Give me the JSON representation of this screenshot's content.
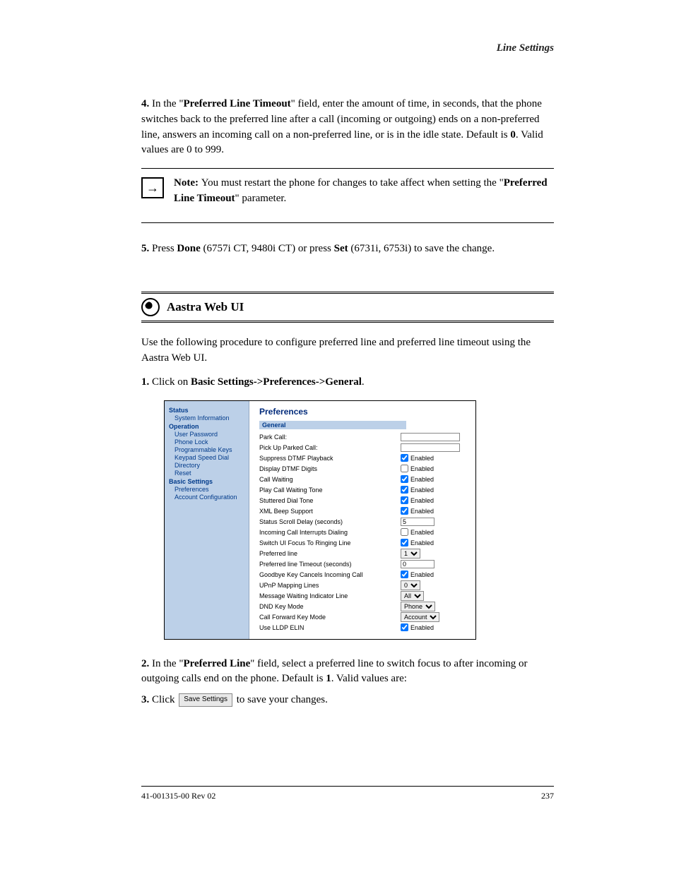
{
  "header": {
    "right_title": "Line Settings"
  },
  "paragraphs": {
    "p1_prefix": "4.",
    "p1": "In the \"",
    "p1_bold": "Preferred Line Timeout",
    "p1_suffix": "\" field, enter the amount of time, in seconds, that the phone switches back to the preferred line after a call (incoming or outgoing) ends on a non-preferred line, answers an incoming call on a non-preferred line, or is in the idle state. Default is ",
    "p1_default": "0",
    "p1_tail": ". Valid values are 0 to 999.",
    "p2_prefix": "5.",
    "p2_a": "Press ",
    "p2_b": "Done",
    "p2_c": " (6757i CT, 9480i CT) or press ",
    "p2_d": "Set",
    "p2_e": " (6731i, 6753i) to save the change.",
    "note_label": "Note: ",
    "note_body": "You must restart the phone for changes to take affect when setting the \"",
    "note_bold": "Preferred Line Timeout",
    "note_tail": "\" parameter.",
    "webui_heading": "Aastra Web UI",
    "intro": "Use the following procedure to configure preferred line and preferred line timeout using the Aastra Web UI.",
    "s1_prefix": "1.",
    "s1_a": "Click on ",
    "s1_b": "Basic Settings->Preferences->General",
    "s1_c": ".",
    "s2_prefix": "2.",
    "s2_a": "In the \"",
    "s2_b": "Preferred Line",
    "s2_c": "\" field, select a preferred line to switch focus to after incoming or outgoing calls end on the phone. Default is ",
    "s2_d": "1",
    "s2_e": ". Valid values are:",
    "s3_prefix": "3.",
    "s3_a": "Click ",
    "s3_savebtn": "Save Settings",
    "s3_b": " to save your changes."
  },
  "shot": {
    "sidebar": {
      "status": "Status",
      "items1": [
        "System Information"
      ],
      "operation": "Operation",
      "items2": [
        "User Password",
        "Phone Lock",
        "Programmable Keys",
        "Keypad Speed Dial",
        "Directory",
        "Reset"
      ],
      "basic": "Basic Settings",
      "items3": [
        "Preferences",
        "Account Configuration"
      ]
    },
    "title": "Preferences",
    "section": "General",
    "rows": [
      {
        "label": "Park Call:",
        "type": "text",
        "value": ""
      },
      {
        "label": "Pick Up Parked Call:",
        "type": "text",
        "value": ""
      },
      {
        "label": "Suppress DTMF Playback",
        "type": "check",
        "checked": true,
        "sfx": "Enabled"
      },
      {
        "label": "Display DTMF Digits",
        "type": "check",
        "checked": false,
        "sfx": "Enabled"
      },
      {
        "label": "Call Waiting",
        "type": "check",
        "checked": true,
        "sfx": "Enabled"
      },
      {
        "label": "Play Call Waiting Tone",
        "type": "check",
        "checked": true,
        "sfx": "Enabled"
      },
      {
        "label": "Stuttered Dial Tone",
        "type": "check",
        "checked": true,
        "sfx": "Enabled"
      },
      {
        "label": "XML Beep Support",
        "type": "check",
        "checked": true,
        "sfx": "Enabled"
      },
      {
        "label": "Status Scroll Delay (seconds)",
        "type": "text",
        "value": "5",
        "cls": "med"
      },
      {
        "label": "Incoming Call Interrupts Dialing",
        "type": "check",
        "checked": false,
        "sfx": "Enabled"
      },
      {
        "label": "Switch UI Focus To Ringing Line",
        "type": "check",
        "checked": true,
        "sfx": "Enabled"
      },
      {
        "label": "Preferred line",
        "type": "select",
        "value": "1"
      },
      {
        "label": "Preferred line Timeout (seconds)",
        "type": "text",
        "value": "0",
        "cls": "med"
      },
      {
        "label": "Goodbye Key Cancels Incoming Call",
        "type": "check",
        "checked": true,
        "sfx": "Enabled"
      },
      {
        "label": "UPnP Mapping Lines",
        "type": "select",
        "value": "0"
      },
      {
        "label": "Message Waiting Indicator Line",
        "type": "select",
        "value": "All"
      },
      {
        "label": "DND Key Mode",
        "type": "select",
        "value": "Phone"
      },
      {
        "label": "Call Forward Key Mode",
        "type": "select",
        "value": "Account"
      },
      {
        "label": "Use LLDP ELIN",
        "type": "check",
        "checked": true,
        "sfx": "Enabled"
      }
    ]
  },
  "footer": {
    "left": "41-001315-00 Rev 02",
    "right": "237"
  }
}
